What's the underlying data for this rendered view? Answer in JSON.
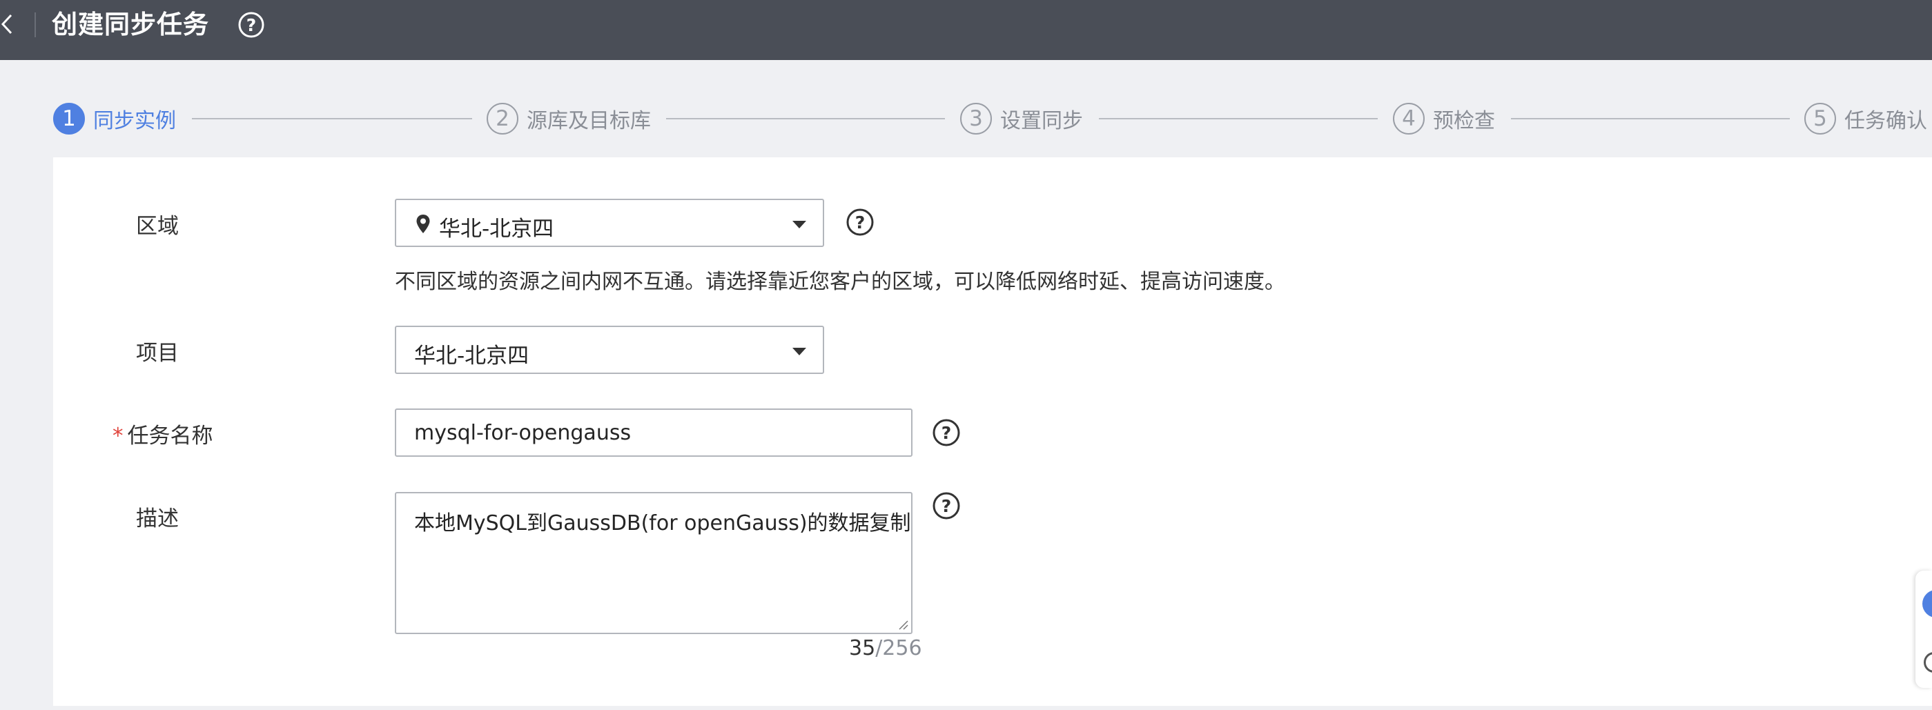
{
  "header": {
    "title": "创建同步任务",
    "back_icon": "chevron-left-icon",
    "help_icon": "question-circle-icon"
  },
  "steps": [
    {
      "number": "1",
      "label": "同步实例",
      "active": true
    },
    {
      "number": "2",
      "label": "源库及目标库",
      "active": false
    },
    {
      "number": "3",
      "label": "设置同步",
      "active": false
    },
    {
      "number": "4",
      "label": "预检查",
      "active": false
    },
    {
      "number": "5",
      "label": "任务确认",
      "active": false
    }
  ],
  "form": {
    "region": {
      "label": "区域",
      "value": "华北-北京四",
      "icon": "location-pin-icon",
      "hint": "不同区域的资源之间内网不互通。请选择靠近您客户的区域，可以降低网络时延、提高访问速度。"
    },
    "project": {
      "label": "项目",
      "value": "华北-北京四"
    },
    "task_name": {
      "required_mark": "*",
      "label": "任务名称",
      "value": "mysql-for-opengauss"
    },
    "description": {
      "label": "描述",
      "value": "本地MySQL到GaussDB(for openGauss)的数据复制",
      "count_current": "35",
      "count_max": "/256"
    }
  },
  "colors": {
    "topbar": "#4a4e57",
    "accent": "#4f80e1",
    "page_bg": "#eff0f3",
    "required": "#e0443c"
  }
}
